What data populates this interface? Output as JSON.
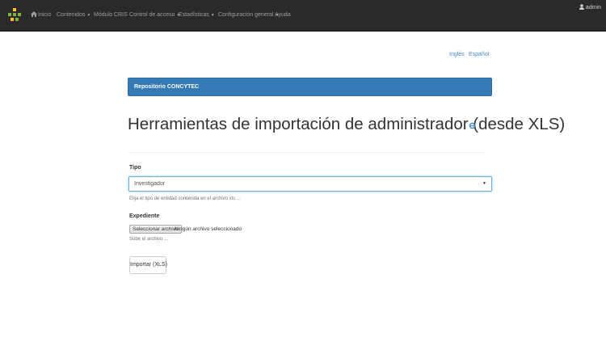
{
  "navbar": {
    "items": [
      {
        "label": "Inicio",
        "has_caret": false
      },
      {
        "label": "Contenidos",
        "has_caret": true
      },
      {
        "label": "Módulo CRIS",
        "has_caret": false
      },
      {
        "label": "Control de acceso",
        "has_caret": true
      },
      {
        "label": "Estadísticas",
        "has_caret": true
      },
      {
        "label": "Configuración general",
        "has_caret": true
      },
      {
        "label": "Ayuda",
        "has_caret": false
      }
    ],
    "caret": "▼",
    "user": "admin"
  },
  "languages": {
    "english": "Inglés",
    "spanish": "Español"
  },
  "breadcrumb": "Repositorio CONCYTEC",
  "page_title": "Herramientas de importación de administrador (desde XLS)",
  "form": {
    "type_label": "Tipo",
    "type_value": "Investigador",
    "type_help": "Elija el tipo de entidad contenida en el archivo xls ...",
    "file_label": "Expediente",
    "file_button": "Seleccionar archivo",
    "file_status": "Ningún archivo seleccionado",
    "file_help": "Sube el archivo ...",
    "submit_label": "Importar (XLS)"
  },
  "colors": {
    "navbar_bg": "#2a2a2a",
    "accent": "#337ab7",
    "link": "#428bca",
    "logo_green": "#7cb342",
    "logo_yellow": "#fbc02d"
  }
}
